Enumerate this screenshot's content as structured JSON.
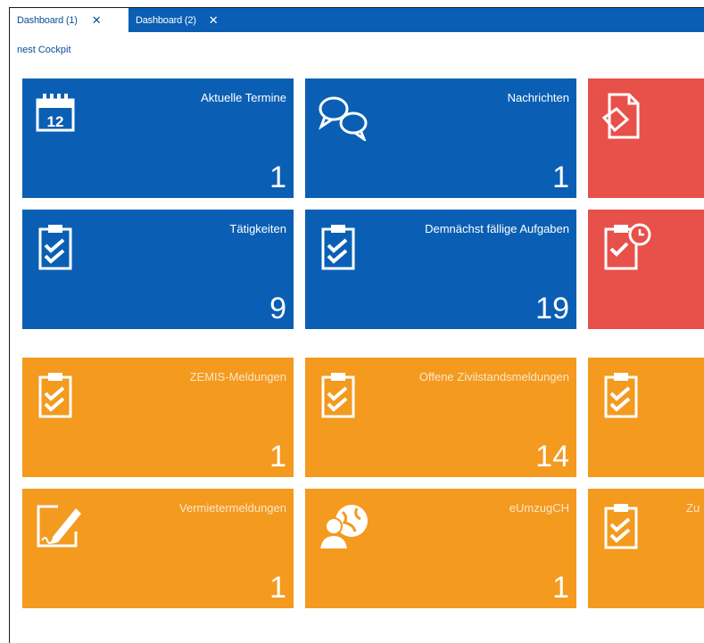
{
  "tabs": [
    {
      "label": "Dashboard (1)",
      "close": "✕"
    },
    {
      "label": "Dashboard (2)",
      "close": "✕"
    }
  ],
  "breadcrumb": "nest Cockpit",
  "tiles": [
    {
      "title": "Aktuelle Termine",
      "count": "1",
      "color": "#0a5fb4",
      "icon": "calendar-icon",
      "calendar_day": "12"
    },
    {
      "title": "Nachrichten",
      "count": "1",
      "color": "#0a5fb4",
      "icon": "chat-bubbles-icon"
    },
    {
      "title": "",
      "count": "",
      "color": "#e8504a",
      "icon": "document-icon"
    },
    {
      "title": "Tätigkeiten",
      "count": "9",
      "color": "#0a5fb4",
      "icon": "clipboard-check-icon"
    },
    {
      "title": "Demnächst fällige Aufgaben",
      "count": "19",
      "color": "#0a5fb4",
      "icon": "clipboard-check-icon"
    },
    {
      "title": "",
      "count": "",
      "color": "#e8504a",
      "icon": "clipboard-clock-icon"
    },
    {
      "title": "ZEMIS-Meldungen",
      "count": "1",
      "color": "#f39a1f",
      "icon": "clipboard-check-icon"
    },
    {
      "title": "Offene Zivilstandsmeldungen",
      "count": "14",
      "color": "#f39a1f",
      "icon": "clipboard-check-icon"
    },
    {
      "title": "",
      "count": "",
      "color": "#f39a1f",
      "icon": "clipboard-check-icon"
    },
    {
      "title": "Vermietermeldungen",
      "count": "1",
      "color": "#f39a1f",
      "icon": "signature-pen-icon"
    },
    {
      "title": "eUmzugCH",
      "count": "1",
      "color": "#f39a1f",
      "icon": "globe-user-icon"
    },
    {
      "title": "Zu",
      "count": "",
      "color": "#f39a1f",
      "icon": "clipboard-check-icon"
    }
  ]
}
